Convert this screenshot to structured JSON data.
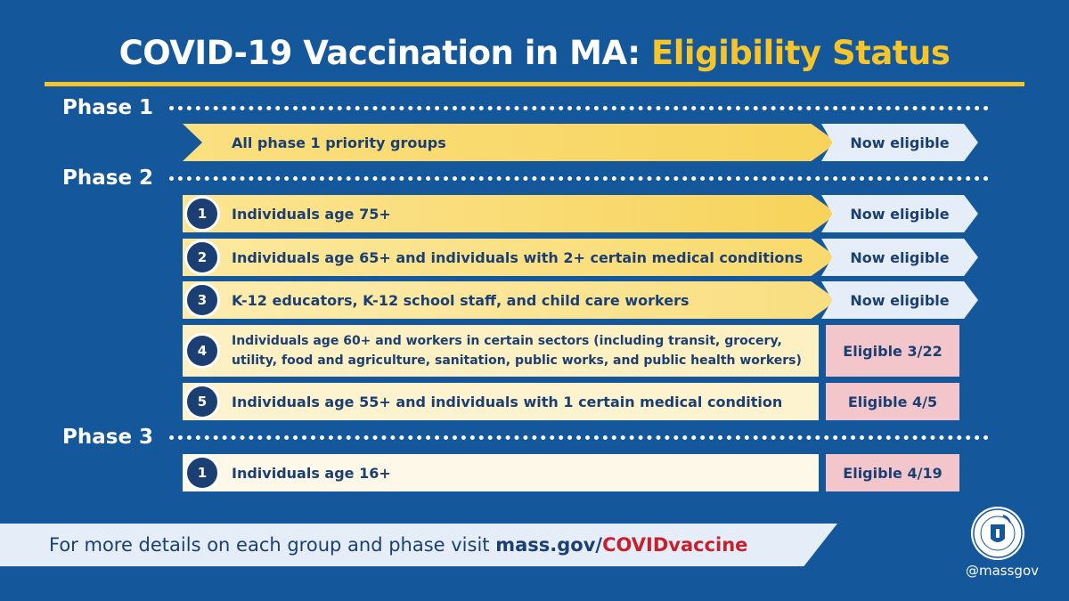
{
  "title": {
    "main": "COVID-19 Vaccination in MA: ",
    "highlight": "Eligibility Status"
  },
  "phases": [
    {
      "label": "Phase 1",
      "rows": [
        {
          "num": "",
          "text": "All phase 1 priority groups",
          "status": "Now eligible"
        }
      ]
    },
    {
      "label": "Phase 2",
      "rows": [
        {
          "num": "1",
          "text": "Individuals age 75+",
          "status": "Now eligible"
        },
        {
          "num": "2",
          "text": "Individuals age 65+ and individuals with 2+ certain medical conditions",
          "status": "Now eligible"
        },
        {
          "num": "3",
          "text": "K-12 educators, K-12 school staff, and child care workers",
          "status": "Now eligible"
        },
        {
          "num": "4",
          "text": "Individuals age 60+ and workers in certain sectors (including transit, grocery, utility, food and agriculture, sanitation, public works, and public health workers)",
          "status": "Eligible 3/22"
        },
        {
          "num": "5",
          "text": "Individuals age 55+ and individuals with 1 certain medical condition",
          "status": "Eligible 4/5"
        }
      ]
    },
    {
      "label": "Phase 3",
      "rows": [
        {
          "num": "1",
          "text": "Individuals age 16+",
          "status": "Eligible 4/19"
        }
      ]
    }
  ],
  "footer": {
    "prefix": "For more details on each group and phase visit ",
    "site": "mass.gov/",
    "path": "COVIDvaccine"
  },
  "handle": "@massgov",
  "colors": {
    "background": "#14579a",
    "accent_yellow": "#f6c42b",
    "navy": "#1b3f73",
    "red": "#c8202c",
    "pink_status": "#f2c6ca",
    "light_status": "#e5eef8"
  }
}
